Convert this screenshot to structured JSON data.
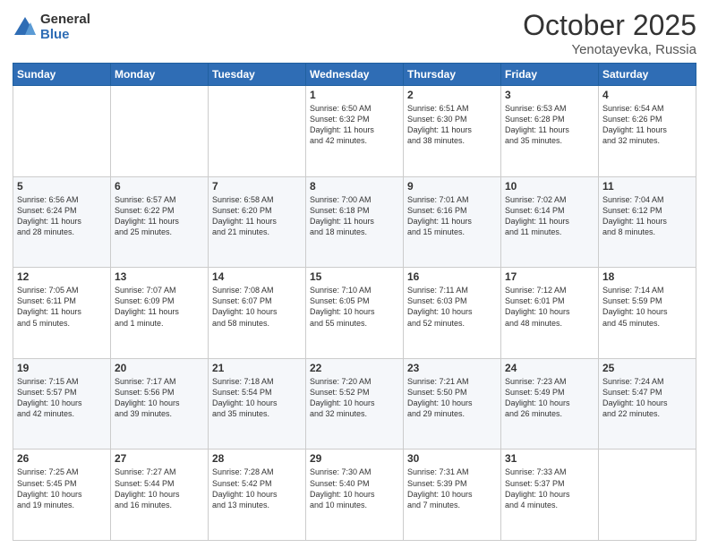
{
  "header": {
    "logo_general": "General",
    "logo_blue": "Blue",
    "month": "October 2025",
    "location": "Yenotayevka, Russia"
  },
  "days_of_week": [
    "Sunday",
    "Monday",
    "Tuesday",
    "Wednesday",
    "Thursday",
    "Friday",
    "Saturday"
  ],
  "weeks": [
    [
      {
        "day": "",
        "info": ""
      },
      {
        "day": "",
        "info": ""
      },
      {
        "day": "",
        "info": ""
      },
      {
        "day": "1",
        "info": "Sunrise: 6:50 AM\nSunset: 6:32 PM\nDaylight: 11 hours\nand 42 minutes."
      },
      {
        "day": "2",
        "info": "Sunrise: 6:51 AM\nSunset: 6:30 PM\nDaylight: 11 hours\nand 38 minutes."
      },
      {
        "day": "3",
        "info": "Sunrise: 6:53 AM\nSunset: 6:28 PM\nDaylight: 11 hours\nand 35 minutes."
      },
      {
        "day": "4",
        "info": "Sunrise: 6:54 AM\nSunset: 6:26 PM\nDaylight: 11 hours\nand 32 minutes."
      }
    ],
    [
      {
        "day": "5",
        "info": "Sunrise: 6:56 AM\nSunset: 6:24 PM\nDaylight: 11 hours\nand 28 minutes."
      },
      {
        "day": "6",
        "info": "Sunrise: 6:57 AM\nSunset: 6:22 PM\nDaylight: 11 hours\nand 25 minutes."
      },
      {
        "day": "7",
        "info": "Sunrise: 6:58 AM\nSunset: 6:20 PM\nDaylight: 11 hours\nand 21 minutes."
      },
      {
        "day": "8",
        "info": "Sunrise: 7:00 AM\nSunset: 6:18 PM\nDaylight: 11 hours\nand 18 minutes."
      },
      {
        "day": "9",
        "info": "Sunrise: 7:01 AM\nSunset: 6:16 PM\nDaylight: 11 hours\nand 15 minutes."
      },
      {
        "day": "10",
        "info": "Sunrise: 7:02 AM\nSunset: 6:14 PM\nDaylight: 11 hours\nand 11 minutes."
      },
      {
        "day": "11",
        "info": "Sunrise: 7:04 AM\nSunset: 6:12 PM\nDaylight: 11 hours\nand 8 minutes."
      }
    ],
    [
      {
        "day": "12",
        "info": "Sunrise: 7:05 AM\nSunset: 6:11 PM\nDaylight: 11 hours\nand 5 minutes."
      },
      {
        "day": "13",
        "info": "Sunrise: 7:07 AM\nSunset: 6:09 PM\nDaylight: 11 hours\nand 1 minute."
      },
      {
        "day": "14",
        "info": "Sunrise: 7:08 AM\nSunset: 6:07 PM\nDaylight: 10 hours\nand 58 minutes."
      },
      {
        "day": "15",
        "info": "Sunrise: 7:10 AM\nSunset: 6:05 PM\nDaylight: 10 hours\nand 55 minutes."
      },
      {
        "day": "16",
        "info": "Sunrise: 7:11 AM\nSunset: 6:03 PM\nDaylight: 10 hours\nand 52 minutes."
      },
      {
        "day": "17",
        "info": "Sunrise: 7:12 AM\nSunset: 6:01 PM\nDaylight: 10 hours\nand 48 minutes."
      },
      {
        "day": "18",
        "info": "Sunrise: 7:14 AM\nSunset: 5:59 PM\nDaylight: 10 hours\nand 45 minutes."
      }
    ],
    [
      {
        "day": "19",
        "info": "Sunrise: 7:15 AM\nSunset: 5:57 PM\nDaylight: 10 hours\nand 42 minutes."
      },
      {
        "day": "20",
        "info": "Sunrise: 7:17 AM\nSunset: 5:56 PM\nDaylight: 10 hours\nand 39 minutes."
      },
      {
        "day": "21",
        "info": "Sunrise: 7:18 AM\nSunset: 5:54 PM\nDaylight: 10 hours\nand 35 minutes."
      },
      {
        "day": "22",
        "info": "Sunrise: 7:20 AM\nSunset: 5:52 PM\nDaylight: 10 hours\nand 32 minutes."
      },
      {
        "day": "23",
        "info": "Sunrise: 7:21 AM\nSunset: 5:50 PM\nDaylight: 10 hours\nand 29 minutes."
      },
      {
        "day": "24",
        "info": "Sunrise: 7:23 AM\nSunset: 5:49 PM\nDaylight: 10 hours\nand 26 minutes."
      },
      {
        "day": "25",
        "info": "Sunrise: 7:24 AM\nSunset: 5:47 PM\nDaylight: 10 hours\nand 22 minutes."
      }
    ],
    [
      {
        "day": "26",
        "info": "Sunrise: 7:25 AM\nSunset: 5:45 PM\nDaylight: 10 hours\nand 19 minutes."
      },
      {
        "day": "27",
        "info": "Sunrise: 7:27 AM\nSunset: 5:44 PM\nDaylight: 10 hours\nand 16 minutes."
      },
      {
        "day": "28",
        "info": "Sunrise: 7:28 AM\nSunset: 5:42 PM\nDaylight: 10 hours\nand 13 minutes."
      },
      {
        "day": "29",
        "info": "Sunrise: 7:30 AM\nSunset: 5:40 PM\nDaylight: 10 hours\nand 10 minutes."
      },
      {
        "day": "30",
        "info": "Sunrise: 7:31 AM\nSunset: 5:39 PM\nDaylight: 10 hours\nand 7 minutes."
      },
      {
        "day": "31",
        "info": "Sunrise: 7:33 AM\nSunset: 5:37 PM\nDaylight: 10 hours\nand 4 minutes."
      },
      {
        "day": "",
        "info": ""
      }
    ]
  ]
}
